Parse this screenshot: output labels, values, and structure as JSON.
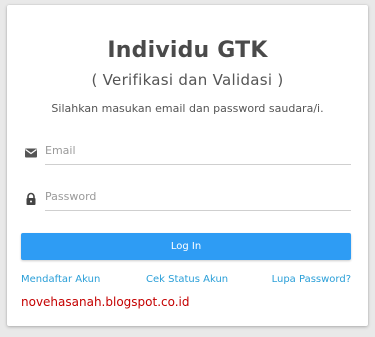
{
  "card": {
    "title": "Individu GTK",
    "subtitle": "( Verifikasi dan Validasi )",
    "hint": "Silahkan masukan email dan password saudara/i."
  },
  "form": {
    "email": {
      "placeholder": "Email",
      "value": "",
      "icon": "email-icon"
    },
    "password": {
      "placeholder": "Password",
      "value": "",
      "icon": "lock-icon"
    },
    "login_label": "Log In"
  },
  "links": {
    "register": "Mendaftar Akun",
    "check_status": "Cek Status Akun",
    "forgot_password": "Lupa Password?"
  },
  "watermark": "novehasanah.blogspot.co.id",
  "colors": {
    "primary": "#2e9cf4",
    "link": "#2a9fd8",
    "watermark": "#c40000"
  }
}
